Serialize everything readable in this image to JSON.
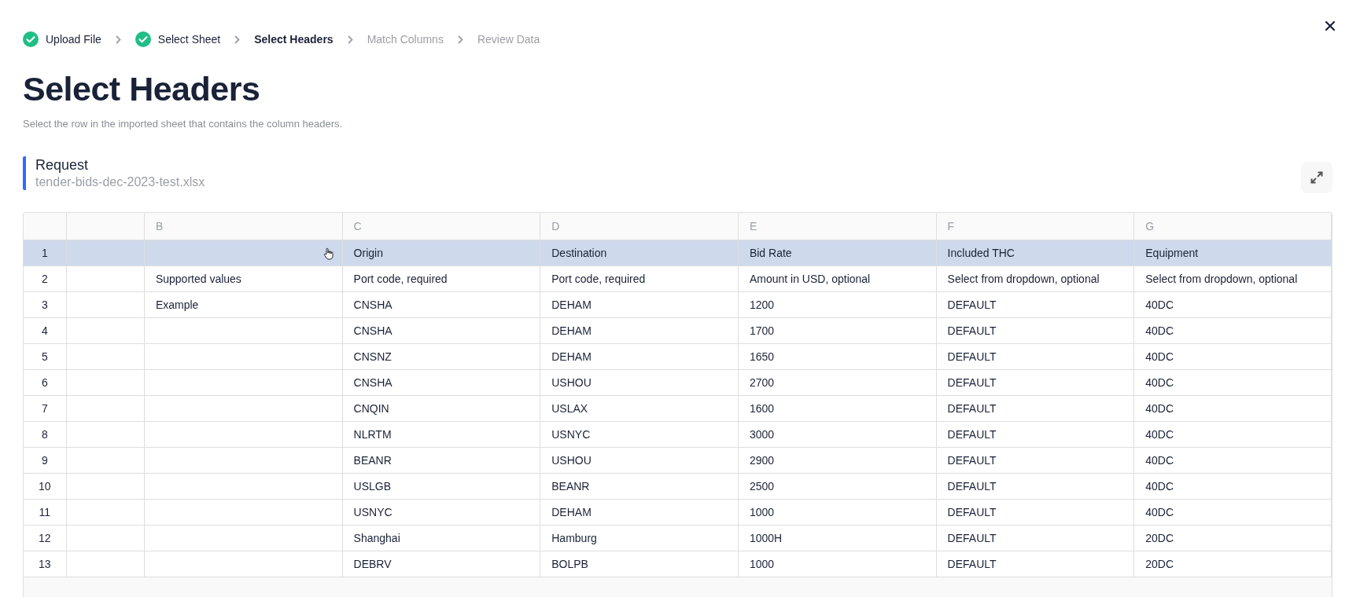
{
  "steps": [
    {
      "label": "Upload File",
      "completed": true,
      "selected": false
    },
    {
      "label": "Select Sheet",
      "completed": true,
      "selected": false
    },
    {
      "label": "Select Headers",
      "completed": false,
      "selected": true
    },
    {
      "label": "Match Columns",
      "completed": false,
      "selected": false
    },
    {
      "label": "Review Data",
      "completed": false,
      "selected": false
    }
  ],
  "title": "Select Headers",
  "subtitle": "Select the row in the imported sheet that contains the column headers.",
  "sheet": {
    "name": "Request",
    "file": "tender-bids-dec-2023-test.xlsx"
  },
  "table": {
    "columns": [
      {},
      {
        "label": "B"
      },
      {
        "label": "C"
      },
      {
        "label": "D"
      },
      {
        "label": "E"
      },
      {
        "label": "F"
      },
      {
        "label": "G"
      }
    ],
    "rows": [
      {
        "number": "1",
        "selected": true,
        "cells": [
          null,
          null,
          "Origin",
          "Destination",
          "Bid Rate",
          "Included THC",
          "Equipment"
        ]
      },
      {
        "number": "2",
        "selected": false,
        "cells": [
          null,
          "Supported values",
          "Port code, required",
          "Port code, required",
          "Amount in USD, optional",
          "Select from dropdown, optional",
          "Select from dropdown, optional"
        ]
      },
      {
        "number": "3",
        "selected": false,
        "cells": [
          null,
          "Example",
          "CNSHA",
          "DEHAM",
          "1200",
          "DEFAULT",
          "40DC"
        ]
      },
      {
        "number": "4",
        "selected": false,
        "cells": [
          null,
          null,
          "CNSHA",
          "DEHAM",
          "1700",
          "DEFAULT",
          "40DC"
        ]
      },
      {
        "number": "5",
        "selected": false,
        "cells": [
          null,
          null,
          "CNSNZ",
          "DEHAM",
          "1650",
          "DEFAULT",
          "40DC"
        ]
      },
      {
        "number": "6",
        "selected": false,
        "cells": [
          null,
          null,
          "CNSHA",
          "USHOU",
          "2700",
          "DEFAULT",
          "40DC"
        ]
      },
      {
        "number": "7",
        "selected": false,
        "cells": [
          null,
          null,
          "CNQIN",
          "USLAX",
          "1600",
          "DEFAULT",
          "40DC"
        ]
      },
      {
        "number": "8",
        "selected": false,
        "cells": [
          null,
          null,
          "NLRTM",
          "USNYC",
          "3000",
          "DEFAULT",
          "40DC"
        ]
      },
      {
        "number": "9",
        "selected": false,
        "cells": [
          null,
          null,
          "BEANR",
          "USHOU",
          "2900",
          "DEFAULT",
          "40DC"
        ]
      },
      {
        "number": "10",
        "selected": false,
        "cells": [
          null,
          null,
          "USLGB",
          "BEANR",
          "2500",
          "DEFAULT",
          "40DC"
        ]
      },
      {
        "number": "11",
        "selected": false,
        "cells": [
          null,
          null,
          "USNYC",
          "DEHAM",
          "1000",
          "DEFAULT",
          "40DC"
        ]
      },
      {
        "number": "12",
        "selected": false,
        "cells": [
          null,
          null,
          "Shanghai",
          "Hamburg",
          "1000H",
          "DEFAULT",
          "20DC"
        ]
      },
      {
        "number": "13",
        "selected": false,
        "cells": [
          null,
          null,
          "DEBRV",
          "BOLPB",
          "1000",
          "DEFAULT",
          "20DC"
        ]
      }
    ]
  }
}
